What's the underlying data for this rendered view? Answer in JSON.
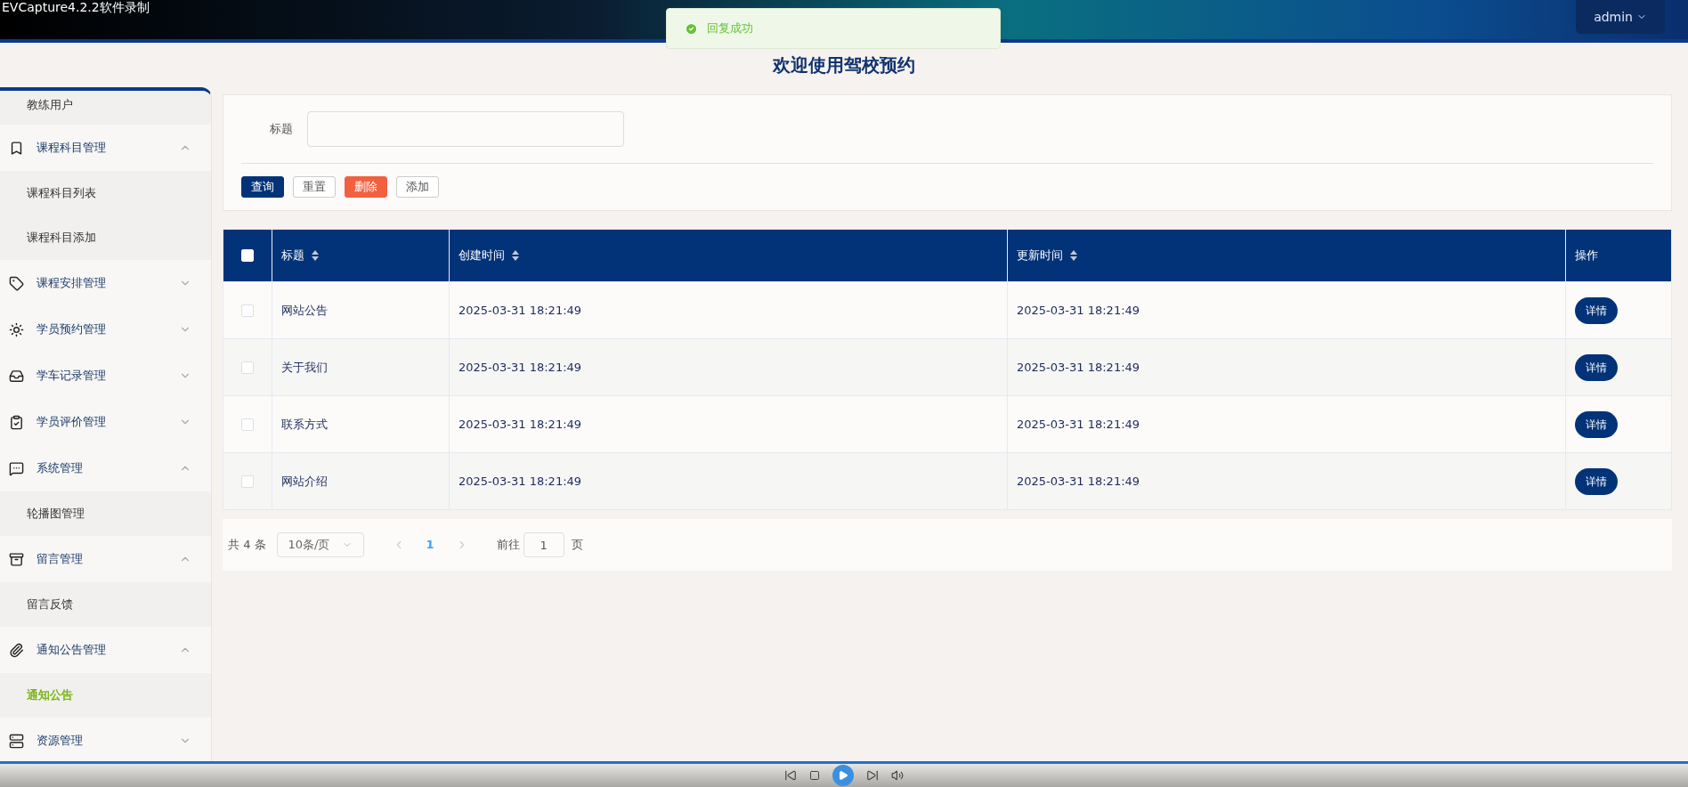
{
  "recorder_watermark": "EVCapture4.2.2软件录制",
  "toast": {
    "message": "回复成功"
  },
  "user_menu": {
    "label": "admin"
  },
  "page_title": "欢迎使用驾校预约",
  "sidebar": {
    "items": [
      {
        "kind": "sub",
        "label": "教练用户",
        "selected": false
      },
      {
        "kind": "group",
        "label": "课程科目管理",
        "expanded": true
      },
      {
        "kind": "sub",
        "label": "课程科目列表",
        "selected": false
      },
      {
        "kind": "sub",
        "label": "课程科目添加",
        "selected": false
      },
      {
        "kind": "group",
        "label": "课程安排管理",
        "expanded": false
      },
      {
        "kind": "group",
        "label": "学员预约管理",
        "expanded": false
      },
      {
        "kind": "group",
        "label": "学车记录管理",
        "expanded": false
      },
      {
        "kind": "group",
        "label": "学员评价管理",
        "expanded": false
      },
      {
        "kind": "group",
        "label": "系统管理",
        "expanded": true
      },
      {
        "kind": "sub",
        "label": "轮播图管理",
        "selected": false
      },
      {
        "kind": "group",
        "label": "留言管理",
        "expanded": true
      },
      {
        "kind": "sub",
        "label": "留言反馈",
        "selected": false
      },
      {
        "kind": "group",
        "label": "通知公告管理",
        "expanded": true
      },
      {
        "kind": "sub",
        "label": "通知公告",
        "selected": true
      },
      {
        "kind": "group",
        "label": "资源管理",
        "expanded": false
      }
    ]
  },
  "search": {
    "label": "标题"
  },
  "buttons": [
    {
      "kind": "primary",
      "label": "查询"
    },
    {
      "kind": "plain",
      "label": "重置"
    },
    {
      "kind": "danger",
      "label": "删除"
    },
    {
      "kind": "plain",
      "label": "添加"
    }
  ],
  "table": {
    "select_all_checked": false,
    "columns": [
      {
        "label": "标题",
        "sortable": true
      },
      {
        "label": "创建时间",
        "sortable": true
      },
      {
        "label": "更新时间",
        "sortable": true
      },
      {
        "label": "操作",
        "sortable": false
      }
    ],
    "rows": [
      {
        "checked": false,
        "title": "网站公告",
        "created": "2025-03-31 18:21:49",
        "updated": "2025-03-31 18:21:49",
        "action": "详情"
      },
      {
        "checked": false,
        "title": "关于我们",
        "created": "2025-03-31 18:21:49",
        "updated": "2025-03-31 18:21:49",
        "action": "详情"
      },
      {
        "checked": false,
        "title": "联系方式",
        "created": "2025-03-31 18:21:49",
        "updated": "2025-03-31 18:21:49",
        "action": "详情"
      },
      {
        "checked": false,
        "title": "网站介绍",
        "created": "2025-03-31 18:21:49",
        "updated": "2025-03-31 18:21:49",
        "action": "详情"
      }
    ]
  },
  "pagination": {
    "total": "共 4 条",
    "page_size": "10条/页",
    "pages": [
      {
        "label": "1",
        "selected": true
      }
    ],
    "goto_label": "前往",
    "goto_value": "1",
    "goto_suffix": "页"
  }
}
